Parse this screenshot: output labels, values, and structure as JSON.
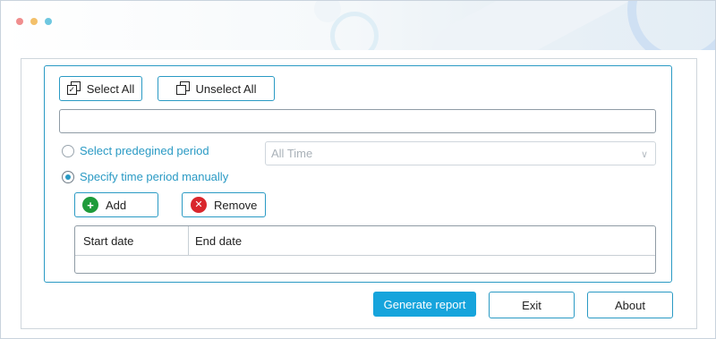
{
  "toolbar": {
    "select_all_label": "Select All",
    "unselect_all_label": "Unselect All"
  },
  "filter": {
    "text_value": ""
  },
  "period": {
    "predefined_label": "Select predegined period",
    "predefined_selected": false,
    "predefined_value": "All Time",
    "manual_label": "Specify time period manually",
    "manual_selected": true
  },
  "actions": {
    "add_label": "Add",
    "remove_label": "Remove"
  },
  "table": {
    "columns": [
      "Start date",
      "End date"
    ],
    "rows": []
  },
  "footer": {
    "generate_label": "Generate report",
    "exit_label": "Exit",
    "about_label": "About"
  },
  "colors": {
    "accent": "#16a4dc",
    "border_accent": "#2a9ac4",
    "add_icon": "#1e9b3a",
    "remove_icon": "#d9262c"
  },
  "icons": {
    "select_all": "checked-copy-icon",
    "unselect_all": "copy-icon",
    "add": "plus-circle-icon",
    "remove": "x-circle-icon",
    "dropdown": "chevron-down-icon"
  }
}
